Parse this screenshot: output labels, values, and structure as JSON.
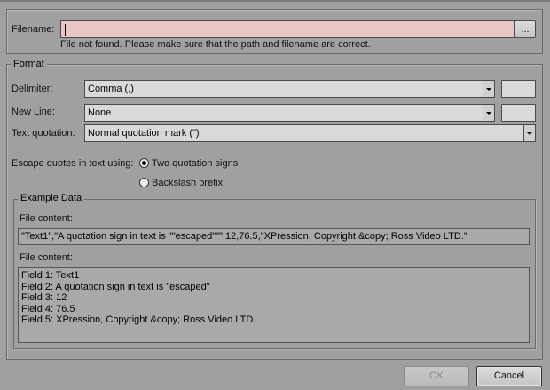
{
  "filename": {
    "label": "Filename:",
    "value": "",
    "browse_label": "...",
    "error_message": "File not found. Please make sure that the path and filename are correct."
  },
  "format": {
    "title": "Format",
    "delimiter": {
      "label": "Delimiter:",
      "selected": "Comma (,)",
      "custom_value": ""
    },
    "newline": {
      "label": "New Line:",
      "selected": "None",
      "custom_value": ""
    },
    "text_quotation": {
      "label": "Text quotation:",
      "selected": "Normal quotation mark (\")"
    },
    "escape": {
      "label": "Escape quotes in text using:",
      "options": [
        {
          "label": "Two quotation signs",
          "checked": true
        },
        {
          "label": "Backslash prefix",
          "checked": false
        }
      ]
    },
    "example": {
      "title": "Example Data",
      "content_label_1": "File content:",
      "raw_line": "\"Text1\",\"A quotation sign in text is \"\"escaped\"\"\",12,76.5,\"XPression, Copyright &copy; Ross Video LTD.\"",
      "content_label_2": "File content:",
      "fields": [
        "Field 1: Text1",
        "Field 2: A quotation sign in text is \"escaped\"",
        "Field 3: 12",
        "Field 4: 76.5",
        "Field 5: XPression, Copyright &copy; Ross Video LTD."
      ]
    }
  },
  "footer": {
    "ok_label": "OK",
    "cancel_label": "Cancel"
  }
}
